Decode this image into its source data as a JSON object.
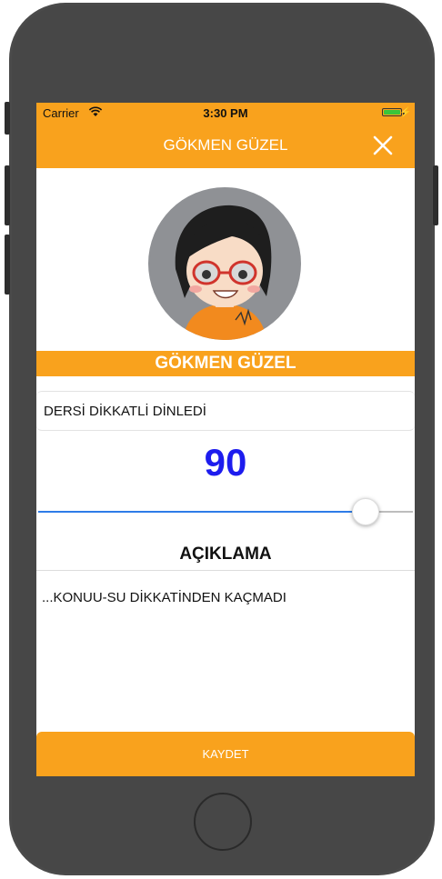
{
  "status_bar": {
    "carrier": "Carrier",
    "time": "3:30 PM",
    "battery_color": "#3ac53a",
    "icons": [
      "wifi-icon",
      "battery-icon",
      "charging-bolt-icon"
    ]
  },
  "nav": {
    "title": "GÖKMEN GÜZEL",
    "close_icon": "close-icon",
    "bar_color": "#f9a21d"
  },
  "profile": {
    "avatar_icon": "avatar-illustration",
    "name": "GÖKMEN GÜZEL"
  },
  "behavior": {
    "label": "DERSİ DİKKATLİ DİNLEDİ"
  },
  "score": {
    "value": "90",
    "color": "#1d1cee",
    "slider_fraction": 0.9,
    "slider_color": "#2e7ce8"
  },
  "description": {
    "title": "AÇIKLAMA",
    "text": "...KONUU-SU DİKKATİNDEN KAÇMADI"
  },
  "actions": {
    "save_label": "KAYDET"
  }
}
